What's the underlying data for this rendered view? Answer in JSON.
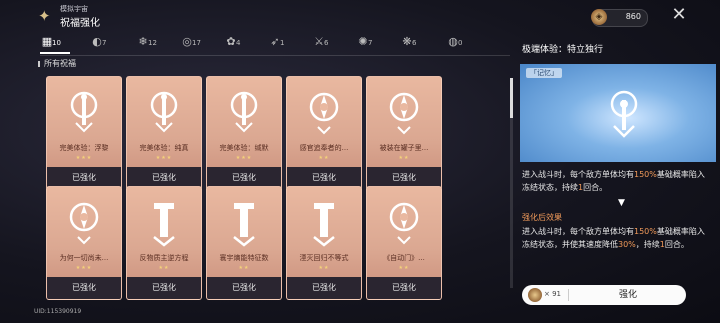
{
  "header": {
    "crumb": "模拟宇宙",
    "title": "祝福强化",
    "currency_value": "860"
  },
  "tabs": [
    {
      "icon": "all-icon",
      "count": "10"
    },
    {
      "icon": "preservation-icon",
      "count": "7"
    },
    {
      "icon": "remembrance-icon",
      "count": "12"
    },
    {
      "icon": "nihility-icon",
      "count": "17"
    },
    {
      "icon": "abundance-icon",
      "count": "4"
    },
    {
      "icon": "hunt-icon",
      "count": "1"
    },
    {
      "icon": "destruction-icon",
      "count": "6"
    },
    {
      "icon": "elation-icon",
      "count": "7"
    },
    {
      "icon": "propagation-icon",
      "count": "6"
    },
    {
      "icon": "erudition-icon",
      "count": "0"
    }
  ],
  "section_title": "所有祝福",
  "cards": [
    {
      "name": "完美体验：浮黎",
      "stars": "★★★",
      "status": "已强化"
    },
    {
      "name": "完美体验：纯真",
      "stars": "★★★",
      "status": "已强化"
    },
    {
      "name": "完美体验：缄默",
      "stars": "★★★",
      "status": "已强化"
    },
    {
      "name": "感官追奉者的...",
      "stars": "★★",
      "status": "已强化"
    },
    {
      "name": "被装在罐子里...",
      "stars": "★★",
      "status": "已强化"
    },
    {
      "name": "为何一切尚未...",
      "stars": "★★★",
      "status": "已强化"
    },
    {
      "name": "反物质主逆方程",
      "stars": "★★",
      "status": "已强化"
    },
    {
      "name": "寰宇熵能特征数",
      "stars": "★★",
      "status": "已强化"
    },
    {
      "name": "湮灭回归不等式",
      "stars": "★★",
      "status": "已强化"
    },
    {
      "name": "《自动门》...",
      "stars": "★★",
      "status": "已强化"
    }
  ],
  "panel": {
    "title": "极端体验：特立独行",
    "tag": "「记忆」",
    "desc1_a": "进入战斗时，每个敌方单体均有",
    "desc1_hl": "150%",
    "desc1_b": "基础概率陷入冻结状态，持续",
    "desc1_hl2": "1",
    "desc1_c": "回合。",
    "sub_title": "强化后效果",
    "desc2_a": "进入战斗时，每个敌方单体均有",
    "desc2_hl": "150%",
    "desc2_b": "基础概率陷入冻结状态，并使其速度降低",
    "desc2_hl2": "30%",
    "desc2_c": "，持续",
    "desc2_hl3": "1",
    "desc2_d": "回合。"
  },
  "bottom": {
    "material_count": "× 91",
    "button_label": "强化"
  },
  "uid": "UID:115390919"
}
